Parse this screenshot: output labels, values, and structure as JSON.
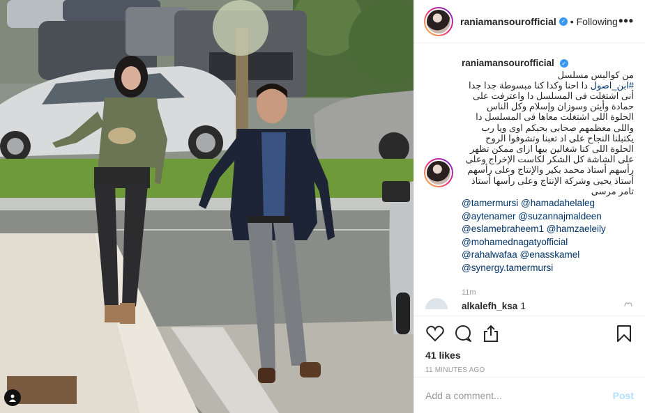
{
  "header": {
    "username": "raniamansourofficial",
    "separator": "•",
    "follow_status": "Following",
    "more_icon": "more-dots-icon"
  },
  "caption": {
    "author": "raniamansourofficial",
    "arabic_text": "من كواليس مسلسل\n#ابن_اصول دا احنا وكدا كنا مبسوطة جدا جدا أنى اشتغلت فى المسلسل دا واعترفت على حمادة وأيتن وسوزان وإسلام وكل الناس الحلوة اللى اشتغلت معاها فى المسلسل دا واللى معظمهم صحابى بحبكم اوى ويا رب يكتبلنا النجاح على اد تعبنا وتشوفوا الروح الحلوة اللى كنا شغالين بيها ازاى ممكن تظهر على الشاشة كل الشكر لكاست الإخراج وعلى رأسهم أستاذ محمد بكير والإنتاج وعلى رأسهم أستاذ يحيى وشركة الإنتاج وعلى رأسها أستاذ تامر مرسى",
    "hashtag": "#ابن_اصول",
    "mentions": [
      [
        "@tamermursi",
        "@hamadahelaleg"
      ],
      [
        "@aytenamer",
        "@suzannajmaldeen"
      ],
      [
        "@eslamebraheem1",
        "@hamzaeleily"
      ],
      [
        "@mohamednagatyofficial"
      ],
      [
        "@rahalwafaa",
        "@enasskamel"
      ],
      [
        "@synergy.tamermursi"
      ]
    ],
    "time": "11m"
  },
  "comment": {
    "username": "alkalefh_ksa",
    "text": "1"
  },
  "actions": {
    "likes": "41 likes",
    "timestamp": "11 MINUTES AGO"
  },
  "add_comment": {
    "placeholder": "Add a comment...",
    "post_label": "Post"
  },
  "colors": {
    "link": "#003569",
    "verified": "#3897f0",
    "post_disabled": "#b2dffc",
    "muted": "#999999"
  }
}
